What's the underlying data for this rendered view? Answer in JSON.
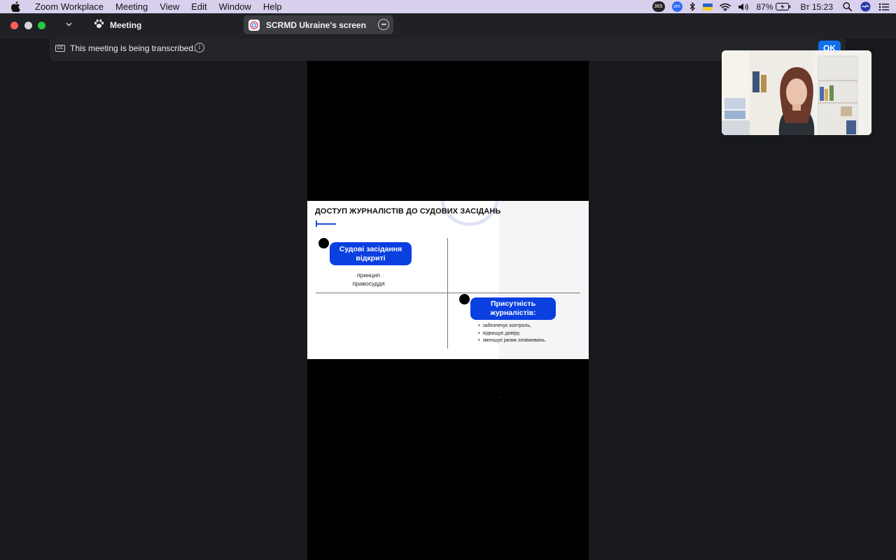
{
  "menubar": {
    "app_name": "Zoom Workplace",
    "menus": [
      "Meeting",
      "View",
      "Edit",
      "Window",
      "Help"
    ],
    "badge_365": "365",
    "badge_zm": "zm",
    "battery": "87%",
    "clock": "Вт 15:23"
  },
  "titlebar": {
    "meeting_label": "Meeting",
    "share_title": "SCRMD Ukraine's screen"
  },
  "banner": {
    "cc_label": "CC",
    "text": "This meeting is being transcribed.",
    "ok_label": "OK"
  },
  "slide": {
    "title": "ДОСТУП ЖУРНАЛІСТІВ ДО СУДОВИХ ЗАСІДАНЬ",
    "card1_title": "Судові засідання відкриті",
    "card1_sub": "принцип правосуддя",
    "card2_title": "Присутність журналістів:",
    "card2_bullets": [
      "забезпечує контроль,",
      "підвищує довіру,",
      "зменшує ризик зловживань."
    ]
  },
  "colors": {
    "accent": "#0a3fe0",
    "zoom_blue": "#0e71eb",
    "menubar_bg": "#d9d0ee",
    "app_bg": "#17191c"
  }
}
